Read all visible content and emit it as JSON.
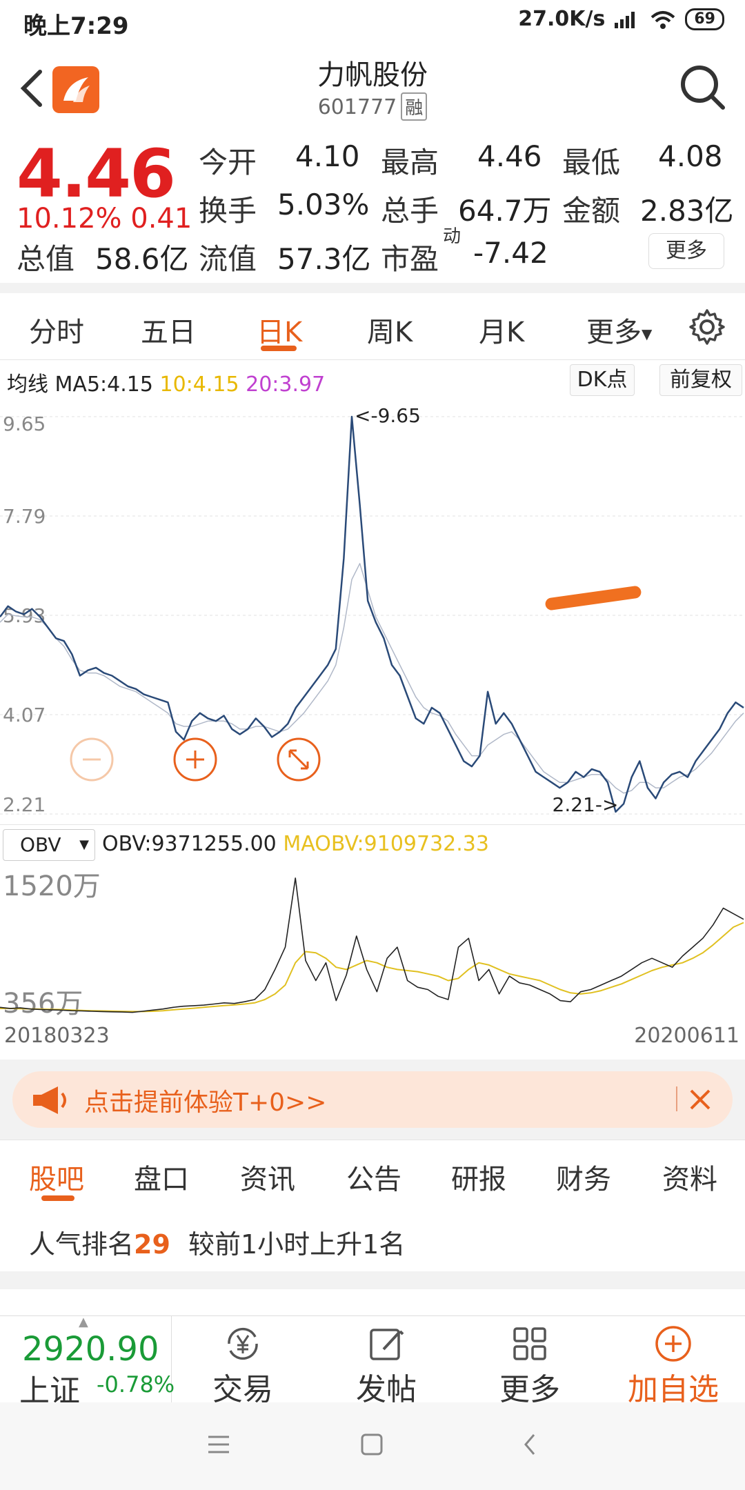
{
  "status": {
    "time": "晚上7:29",
    "speed": "27.0K/s",
    "battery": "69"
  },
  "header": {
    "title": "力帆股份",
    "code": "601777",
    "margin_tag": "融"
  },
  "quote": {
    "price": "4.46",
    "change_pct": "10.12%",
    "change": "0.41",
    "open_label": "今开",
    "open": "4.10",
    "high_label": "最高",
    "high": "4.46",
    "low_label": "最低",
    "low": "4.08",
    "turnover_label": "换手",
    "turnover": "5.03%",
    "volume_label": "总手",
    "volume": "64.7万",
    "amount_label": "金额",
    "amount": "2.83亿",
    "mktcap_label": "总值",
    "mktcap": "58.6亿",
    "float_label": "流值",
    "float": "57.3亿",
    "pe_label": "市盈",
    "pe_sup": "动",
    "pe": "-7.42",
    "more_label": "更多"
  },
  "ktabs": [
    "分时",
    "五日",
    "日K",
    "周K",
    "月K",
    "更多"
  ],
  "ma": {
    "label": "均线",
    "ma5": "MA5:4.15",
    "ma10": "10:4.15",
    "ma20": "20:3.97",
    "dk_label": "DK点",
    "adjust_label": "前复权",
    "ma10_color": "#e8b800",
    "ma20_color": "#c040d0"
  },
  "obv": {
    "selector": "OBV",
    "value": "OBV:9371255.00",
    "maobv": "MAOBV:9109732.33",
    "maobv_color": "#e8c020"
  },
  "chart_data": [
    {
      "type": "line",
      "yticks": [
        "9.65",
        "7.79",
        "5.93",
        "4.07",
        "2.21"
      ],
      "ylim": [
        2.21,
        9.65
      ],
      "max_label": "<-9.65",
      "min_label": "2.21->",
      "grid": true,
      "series": [
        {
          "values": [
            5.9,
            6.1,
            6.0,
            5.95,
            6.05,
            5.9,
            5.7,
            5.5,
            5.45,
            5.2,
            4.8,
            4.9,
            4.95,
            4.85,
            4.8,
            4.7,
            4.6,
            4.55,
            4.45,
            4.4,
            4.35,
            4.3,
            3.75,
            3.6,
            3.95,
            4.1,
            4.0,
            3.95,
            4.05,
            3.8,
            3.7,
            3.8,
            4.0,
            3.85,
            3.65,
            3.75,
            3.9,
            4.2,
            4.4,
            4.6,
            4.8,
            5.0,
            5.3,
            7.0,
            9.65,
            8.0,
            6.2,
            5.8,
            5.5,
            5.0,
            4.8,
            4.4,
            4.0,
            3.9,
            4.2,
            4.1,
            3.8,
            3.5,
            3.2,
            3.1,
            3.3,
            4.5,
            3.9,
            4.1,
            3.9,
            3.6,
            3.3,
            3.0,
            2.9,
            2.8,
            2.7,
            2.8,
            3.0,
            2.9,
            3.05,
            3.0,
            2.8,
            2.25,
            2.4,
            2.9,
            3.2,
            2.7,
            2.5,
            2.8,
            2.95,
            3.0,
            2.9,
            3.2,
            3.4,
            3.6,
            3.8,
            4.1,
            4.3,
            4.2
          ]
        },
        {
          "values": [
            5.8,
            5.95,
            5.92,
            5.9,
            5.9,
            5.85,
            5.7,
            5.5,
            5.35,
            5.1,
            4.9,
            4.85,
            4.85,
            4.8,
            4.7,
            4.6,
            4.55,
            4.5,
            4.4,
            4.3,
            4.2,
            4.1,
            3.9,
            3.85,
            3.85,
            3.9,
            3.95,
            3.95,
            3.95,
            3.9,
            3.8,
            3.8,
            3.85,
            3.85,
            3.8,
            3.75,
            3.8,
            3.95,
            4.1,
            4.3,
            4.5,
            4.7,
            5.0,
            5.7,
            6.6,
            6.9,
            6.4,
            5.9,
            5.6,
            5.3,
            5.0,
            4.7,
            4.4,
            4.2,
            4.1,
            4.05,
            3.95,
            3.7,
            3.5,
            3.3,
            3.3,
            3.5,
            3.6,
            3.7,
            3.75,
            3.6,
            3.4,
            3.2,
            3.0,
            2.9,
            2.8,
            2.8,
            2.85,
            2.9,
            2.95,
            2.95,
            2.85,
            2.7,
            2.6,
            2.65,
            2.8,
            2.8,
            2.7,
            2.7,
            2.8,
            2.9,
            2.95,
            3.05,
            3.2,
            3.35,
            3.55,
            3.75,
            3.95,
            4.1
          ]
        }
      ]
    },
    {
      "type": "line",
      "yticks": [
        "1520万",
        "356万"
      ],
      "ylim": [
        300,
        1600
      ],
      "series": [
        {
          "name": "OBV",
          "values": [
            360,
            350,
            355,
            345,
            340,
            338,
            335,
            330,
            328,
            325,
            322,
            320,
            318,
            315,
            325,
            335,
            345,
            360,
            370,
            375,
            380,
            390,
            400,
            395,
            410,
            430,
            520,
            700,
            900,
            1520,
            780,
            600,
            760,
            420,
            650,
            1000,
            700,
            500,
            800,
            900,
            600,
            540,
            520,
            460,
            430,
            900,
            980,
            600,
            700,
            480,
            640,
            580,
            560,
            520,
            480,
            420,
            410,
            500,
            520,
            560,
            600,
            640,
            700,
            760,
            800,
            760,
            720,
            820,
            900,
            980,
            1100,
            1250,
            1200,
            1150
          ]
        },
        {
          "name": "MAOBV",
          "values": [
            350,
            350,
            348,
            346,
            344,
            342,
            340,
            336,
            332,
            330,
            328,
            326,
            324,
            322,
            322,
            325,
            330,
            338,
            345,
            352,
            360,
            368,
            376,
            382,
            390,
            400,
            430,
            480,
            560,
            760,
            860,
            850,
            800,
            720,
            700,
            740,
            780,
            760,
            720,
            700,
            690,
            680,
            660,
            640,
            600,
            620,
            700,
            760,
            740,
            700,
            660,
            640,
            620,
            600,
            560,
            520,
            490,
            480,
            490,
            510,
            540,
            570,
            610,
            650,
            690,
            720,
            740,
            760,
            800,
            850,
            920,
            1000,
            1080,
            1120
          ]
        }
      ]
    }
  ],
  "dates": {
    "start": "20180323",
    "end": "20200611"
  },
  "promo": {
    "text": "点击提前体验T+0>>"
  },
  "btabs": [
    "股吧",
    "盘口",
    "资讯",
    "公告",
    "研报",
    "财务",
    "资料"
  ],
  "rank": {
    "label": "人气排名",
    "value": "29",
    "desc": "较前1小时上升1名"
  },
  "index": {
    "value": "2920.90",
    "name": "上证",
    "change": "-0.78%"
  },
  "nav": [
    "交易",
    "发帖",
    "更多",
    "加自选"
  ]
}
